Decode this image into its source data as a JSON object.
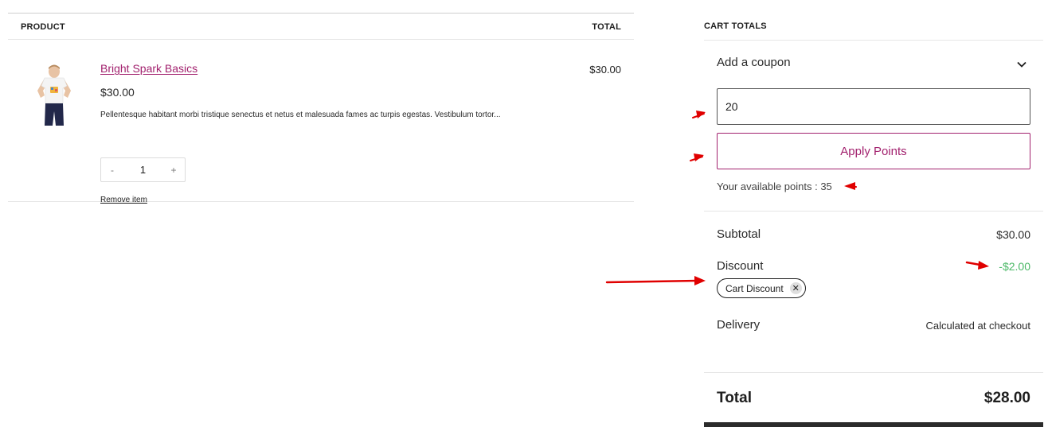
{
  "table": {
    "col_product": "PRODUCT",
    "col_total": "TOTAL"
  },
  "item": {
    "name": "Bright Spark Basics",
    "price": "$30.00",
    "description": "Pellentesque habitant morbi tristique senectus et netus et malesuada fames ac turpis egestas. Vestibulum tortor...",
    "qty_minus": "-",
    "quantity": "1",
    "qty_plus": "+",
    "remove_label": "Remove item",
    "line_total": "$30.00"
  },
  "totals": {
    "title": "CART TOTALS",
    "coupon_toggle": "Add a coupon",
    "points_value": "20",
    "apply_label": "Apply Points",
    "points_note": "Your available points : 35",
    "subtotal_label": "Subtotal",
    "subtotal_value": "$30.00",
    "discount_label": "Discount",
    "discount_value": "-$2.00",
    "discount_chip": "Cart Discount",
    "chip_remove": "✕",
    "delivery_label": "Delivery",
    "delivery_value": "Calculated at checkout",
    "total_label": "Total",
    "total_value": "$28.00"
  },
  "colors": {
    "accent": "#a2216e",
    "discount": "#4ab866",
    "annotation": "#e00000"
  },
  "icons": {
    "chevron": "chevron-down-icon",
    "product_image": "tshirt-kid-image"
  }
}
